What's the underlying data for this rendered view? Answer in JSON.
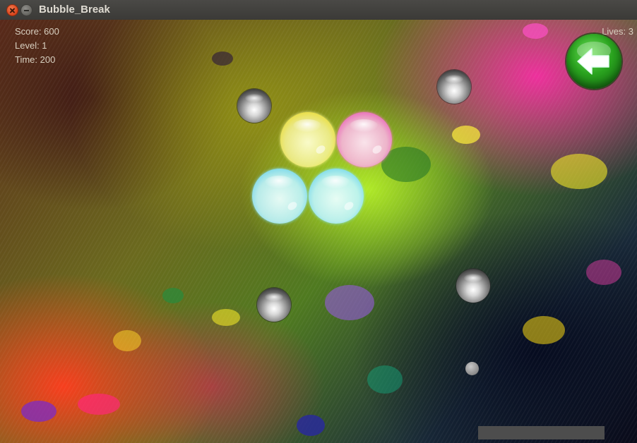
{
  "window": {
    "title": "Bubble_Break"
  },
  "hud": {
    "score": "Score: 600",
    "level": "Level: 1",
    "time": "Time: 200",
    "lives": "Lives: 3"
  },
  "icons": {
    "close": "close-icon",
    "minimize": "minimize-icon",
    "back": "back-arrow-icon"
  },
  "colors": {
    "back_button": "#2aa31f",
    "bubble_yellow": "#f5e63c",
    "bubble_pink": "#f05abe",
    "bubble_cyan": "#6ed7f5",
    "paddle": "#4d4d4d",
    "hud_text": "#d8d0c0"
  },
  "bubbles": [
    "yellow",
    "pink",
    "cyan",
    "cyan"
  ],
  "steel_balls": 4
}
